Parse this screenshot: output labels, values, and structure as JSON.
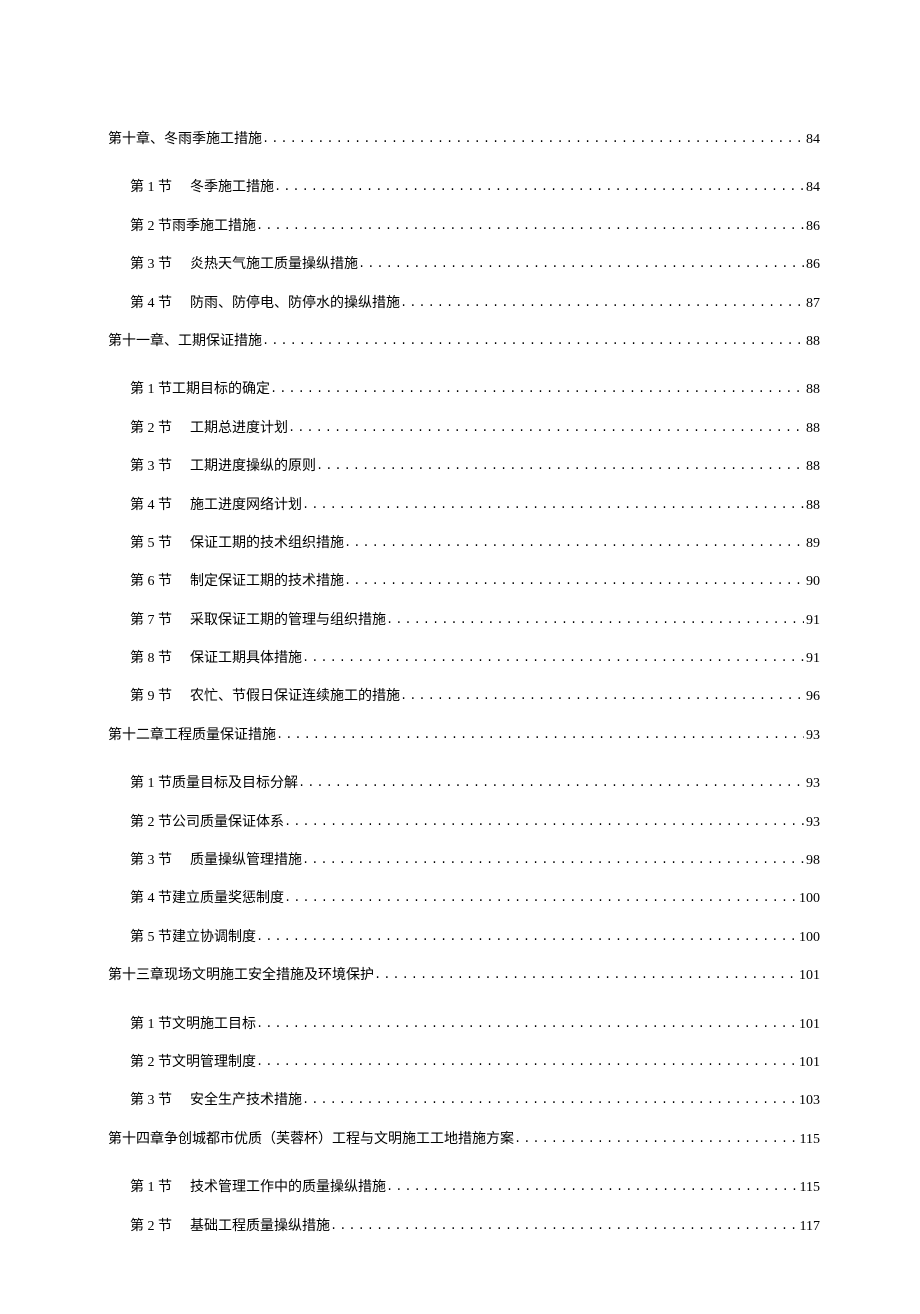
{
  "toc": [
    {
      "level": "chapter",
      "label": "第十章、冬雨季施工措施",
      "page": "84"
    },
    {
      "level": "section",
      "label": "第 1 节<gap>冬季施工措施",
      "page": "84"
    },
    {
      "level": "section",
      "label": "第 2 节雨季施工措施",
      "page": "86"
    },
    {
      "level": "section",
      "label": "第 3 节<gap>炎热天气施工质量操纵措施",
      "page": "86"
    },
    {
      "level": "section",
      "label": "第 4 节<gap>防雨、防停电、防停水的操纵措施",
      "page": "87"
    },
    {
      "level": "chapter",
      "label": "第十一章、工期保证措施",
      "page": "88"
    },
    {
      "level": "section",
      "label": "第 1 节工期目标的确定",
      "page": "88"
    },
    {
      "level": "section",
      "label": "第 2 节<gap>工期总进度计划",
      "page": "88"
    },
    {
      "level": "section",
      "label": "第 3 节<gap>工期进度操纵的原则",
      "page": "88"
    },
    {
      "level": "section",
      "label": "第 4 节<gap>施工进度网络计划",
      "page": "88"
    },
    {
      "level": "section",
      "label": "第 5 节<gap>保证工期的技术组织措施",
      "page": "89"
    },
    {
      "level": "section",
      "label": "第 6 节<gap>制定保证工期的技术措施",
      "page": "90"
    },
    {
      "level": "section",
      "label": "第 7 节<gap>采取保证工期的管理与组织措施",
      "page": "91"
    },
    {
      "level": "section",
      "label": "第 8 节<gap>保证工期具体措施",
      "page": "91"
    },
    {
      "level": "section",
      "label": "第 9 节<gap>农忙、节假日保证连续施工的措施",
      "page": "96"
    },
    {
      "level": "chapter",
      "label": "第十二章工程质量保证措施",
      "page": "93"
    },
    {
      "level": "section",
      "label": "第 1 节质量目标及目标分解",
      "page": "93"
    },
    {
      "level": "section",
      "label": "第 2 节公司质量保证体系",
      "page": "93"
    },
    {
      "level": "section",
      "label": "第 3 节<gap>质量操纵管理措施",
      "page": "98"
    },
    {
      "level": "section",
      "label": "第 4 节建立质量奖惩制度",
      "page": "100"
    },
    {
      "level": "section",
      "label": "第 5 节建立协调制度",
      "page": "100"
    },
    {
      "level": "chapter",
      "label": "第十三章现场文明施工安全措施及环境保护",
      "page": "101"
    },
    {
      "level": "section",
      "label": "第 1 节文明施工目标",
      "page": "101"
    },
    {
      "level": "section",
      "label": "第 2 节文明管理制度",
      "page": "101"
    },
    {
      "level": "section",
      "label": "第 3 节<gap>安全生产技术措施",
      "page": "103"
    },
    {
      "level": "chapter",
      "label": "第十四章争创城都市优质（芙蓉杯）工程与文明施工工地措施方案",
      "page": "115"
    },
    {
      "level": "section",
      "label": "第 1 节<gap>技术管理工作中的质量操纵措施",
      "page": "115"
    },
    {
      "level": "section",
      "label": "第 2 节<gap>基础工程质量操纵措施",
      "page": "117"
    }
  ]
}
